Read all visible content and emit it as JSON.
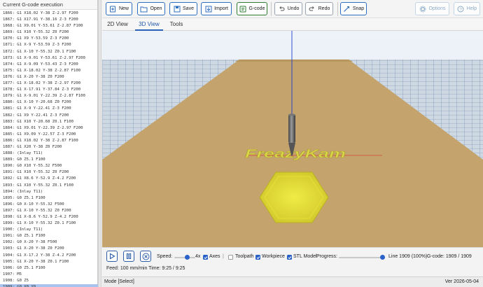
{
  "left_panel": {
    "title": "Current G-code execution",
    "lines": [
      "1866: G1 X18.02 Y-38 Z-2.97 F200",
      "1867: G1 X17.91 Y-38.16 Z-3 F200",
      "1868: G1 X9.01 Y-53.61 Z-2.87 F100",
      "1869: G1 X10 Y-55.32 Z0 F200",
      "1870: G1 X9 Y-53.59 Z-3 F200",
      "1871: G1 X-9 Y-53.59 Z-3 F200",
      "1872: G1 X-10 Y-55.32 Z0.1 F100",
      "1873: G1 X-9.01 Y-53.61 Z-2.97 F200",
      "1874: G1 X-9.09 Y-53.43 Z-3 F200",
      "1875: G1 X-18.02 Y-38 Z-2.87 F100",
      "1876: G1 X-20 Y-38 Z0 F200",
      "1877: G1 X-18.02 Y-38 Z-2.97 F200",
      "1878: G1 X-17.91 Y-37.84 Z-3 F200",
      "1879: G1 X-9.01 Y-22.39 Z-2.87 F100",
      "1880: G1 X-10 Y-20.68 Z0 F200",
      "1881: G1 X-9 Y-22.41 Z-3 F200",
      "1882: G1 X9 Y-22.41 Z-3 F200",
      "1883: G1 X10 Y-20.68 Z0.1 F100",
      "1884: G1 X9.01 Y-22.39 Z-2.97 F200",
      "1885: G1 X9.09 Y-22.57 Z-3 F200",
      "1886: G1 X18.02 Y-38 Z-2.87 F100",
      "1887: G1 X20 Y-38 Z0 F200",
      "1888: (Inlay T11)",
      "1889: G0 Z5.1 F100",
      "1890: G0 X10 Y-55.32 F500",
      "1891: G1 X10 Y-55.32 Z0 F200",
      "1892: G1 X8.6 Y-52.9 Z-4.2 F200",
      "1893: G1 X10 Y-55.32 Z0.1 F100",
      "1894: (Inlay T11)",
      "1895: G0 Z5.1 F100",
      "1896: G0 X-10 Y-55.32 F500",
      "1897: G1 X-10 Y-55.32 Z0 F200",
      "1898: G1 X-8.6 Y-52.9 Z-4.2 F200",
      "1899: G1 X-10 Y-55.32 Z0.1 F100",
      "1900: (Inlay T11)",
      "1901: G0 Z5.1 F100",
      "1902: G0 X-20 Y-38 F500",
      "1903: G1 X-20 Y-38 Z0 F200",
      "1904: G1 X-17.2 Y-38 Z-4.2 F200",
      "1905: G1 X-20 Y-38 Z0.1 F100",
      "1906: G0 Z5.1 F100",
      "1907: M5",
      "1908: G0 Z5",
      "1909: G0 X0 Y0"
    ]
  },
  "toolbar": {
    "new": "New",
    "open": "Open",
    "save": "Save",
    "import": "Import",
    "gcode": "G-code",
    "undo": "Undo",
    "redo": "Redo",
    "snap": "Snap",
    "options": "Options",
    "help": "Help"
  },
  "tabs": [
    "2D View",
    "3D View",
    "Tools"
  ],
  "viewport": {
    "engraved_text": "FreazyKam"
  },
  "controls": {
    "speed_label": "Speed:",
    "speed_value": "4x",
    "speed_fraction": 0.6,
    "axes_label": "Axes",
    "toolpath_label": "Toolpath",
    "workpiece_label": "Workpiece",
    "stl_label": "STL Model",
    "progress_label": "Progress:",
    "progress_fraction": 1.0,
    "line_info": "Line 1909 (100%)",
    "gcode_info": "G-code:  1909 / 1909",
    "feed_info": "Feed:  100 mm/min   Time:  9:25 / 9:25"
  },
  "status": {
    "mode": "Mode [Select]",
    "version": "Ver 2026-05-04"
  },
  "colors": {
    "accent": "#2a62c9",
    "board": "#c4a46c",
    "grid": "#5f7ea0",
    "inlay": "#e2dd2e"
  }
}
